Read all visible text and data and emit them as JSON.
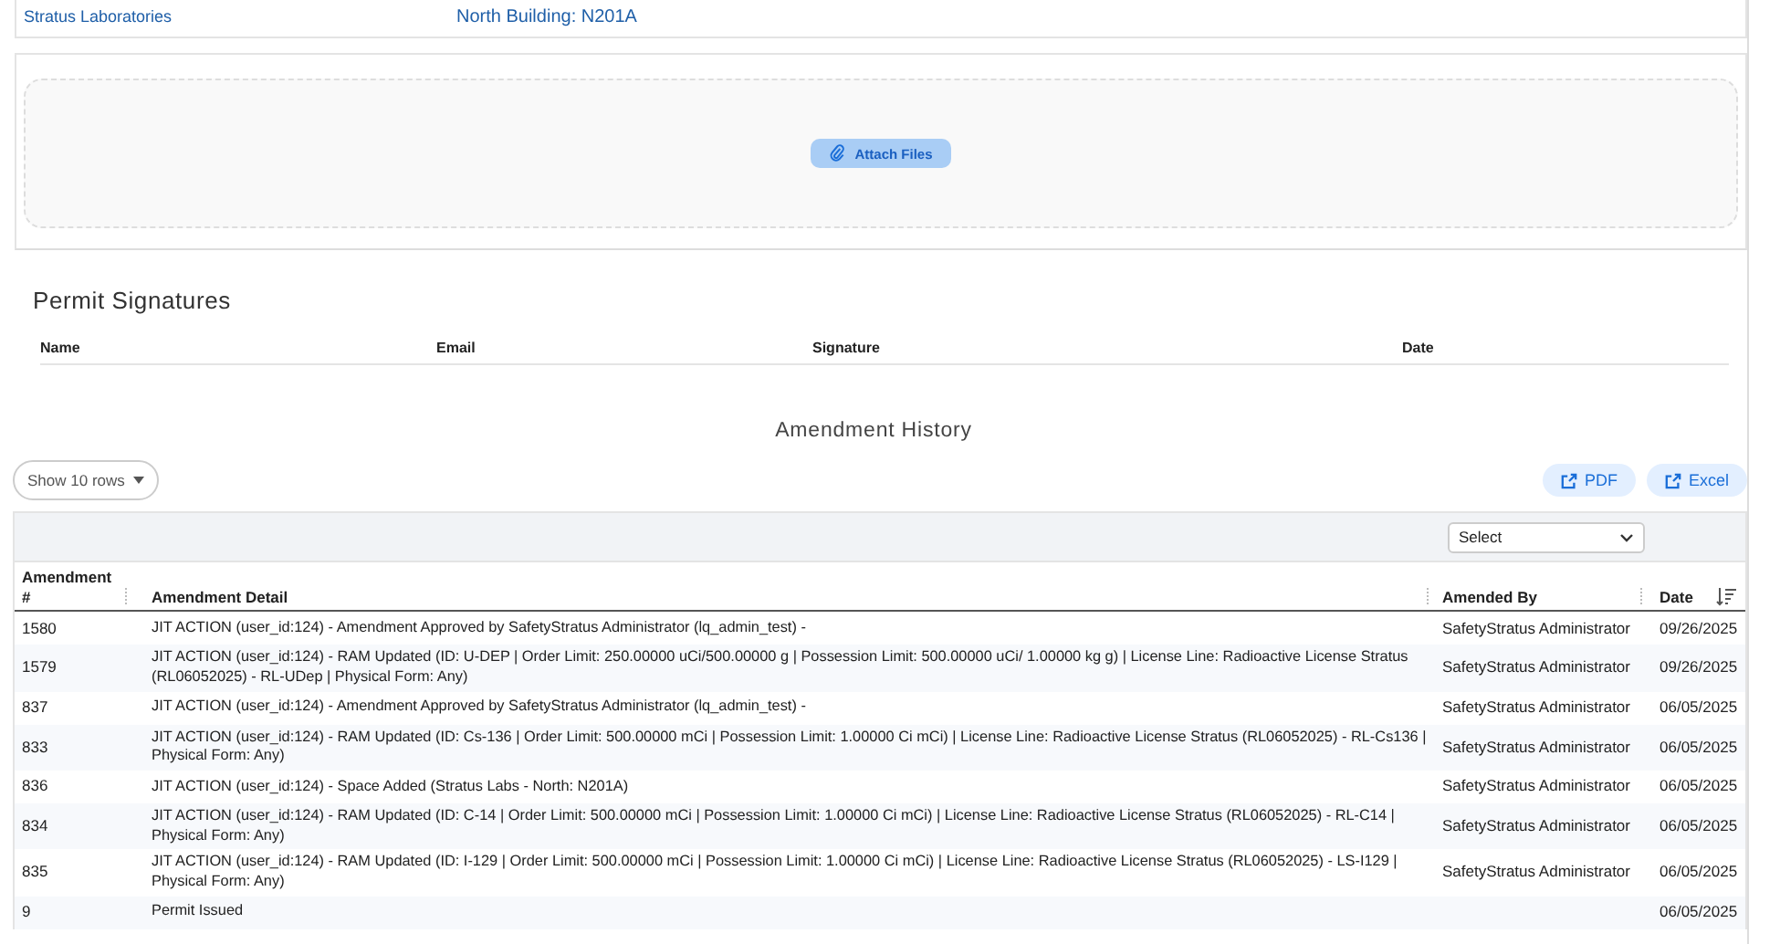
{
  "location": {
    "facility": "Stratus Laboratories",
    "space": "North Building: N201A"
  },
  "attach": {
    "label": "Attach Files"
  },
  "signatures": {
    "title": "Permit Signatures",
    "columns": [
      "Name",
      "Email",
      "Signature",
      "Date"
    ]
  },
  "history": {
    "title": "Amendment History",
    "page_size": "Show 10 rows",
    "exports": [
      "PDF",
      "Excel"
    ],
    "filter": {
      "placeholder": "Select"
    },
    "columns": [
      {
        "label": "Amendment #",
        "sorted": false
      },
      {
        "label": "Amendment Detail",
        "sorted": false
      },
      {
        "label": "Amended By",
        "sorted": false
      },
      {
        "label": "Date",
        "sorted": true
      }
    ],
    "rows": [
      {
        "number": "1580",
        "detail": "JIT ACTION (user_id:124) - Amendment Approved by SafetyStratus Administrator (lq_admin_test) -",
        "by": "SafetyStratus Administrator",
        "date": "09/26/2025"
      },
      {
        "number": "1579",
        "detail": "JIT ACTION (user_id:124) - RAM Updated (ID: U-DEP | Order Limit: 250.00000 uCi/500.00000 g | Possession Limit: 500.00000 uCi/ 1.00000 kg g) | License Line: Radioactive License Stratus (RL06052025) - RL-UDep | Physical Form: Any)",
        "by": "SafetyStratus Administrator",
        "date": "09/26/2025"
      },
      {
        "number": "837",
        "detail": "JIT ACTION (user_id:124) - Amendment Approved by SafetyStratus Administrator (lq_admin_test) -",
        "by": "SafetyStratus Administrator",
        "date": "06/05/2025"
      },
      {
        "number": "833",
        "detail": "JIT ACTION (user_id:124) - RAM Updated (ID: Cs-136 | Order Limit: 500.00000 mCi | Possession Limit: 1.00000 Ci mCi) | License Line: Radioactive License Stratus (RL06052025) - RL-Cs136 | Physical Form: Any)",
        "by": "SafetyStratus Administrator",
        "date": "06/05/2025"
      },
      {
        "number": "836",
        "detail": "JIT ACTION (user_id:124) - Space Added (Stratus Labs - North: N201A)",
        "by": "SafetyStratus Administrator",
        "date": "06/05/2025"
      },
      {
        "number": "834",
        "detail": "JIT ACTION (user_id:124) - RAM Updated (ID: C-14 | Order Limit: 500.00000 mCi | Possession Limit: 1.00000 Ci mCi) | License Line: Radioactive License Stratus (RL06052025) - RL-C14 | Physical Form: Any)",
        "by": "SafetyStratus Administrator",
        "date": "06/05/2025"
      },
      {
        "number": "835",
        "detail": "JIT ACTION (user_id:124) - RAM Updated (ID: I-129 | Order Limit: 500.00000 mCi | Possession Limit: 1.00000 Ci mCi) | License Line: Radioactive License Stratus (RL06052025) - LS-I129 | Physical Form: Any)",
        "by": "SafetyStratus Administrator",
        "date": "06/05/2025"
      },
      {
        "number": "9",
        "detail": "Permit Issued",
        "by": "",
        "date": "06/05/2025"
      }
    ]
  }
}
